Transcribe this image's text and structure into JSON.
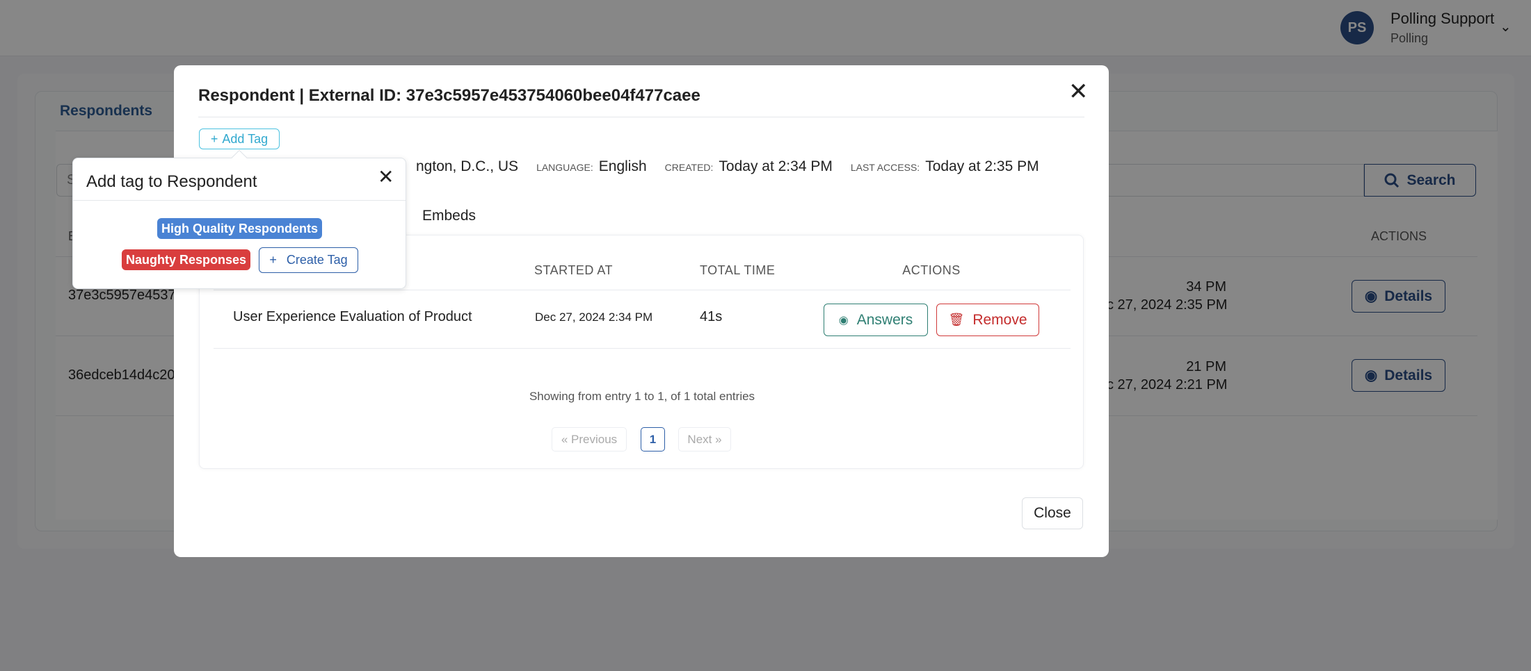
{
  "user": {
    "initials": "PS",
    "name": "Polling Support",
    "org": "Polling"
  },
  "background": {
    "tab": "Respondents",
    "search_button": "Search",
    "column_header_first": "E",
    "column_header_actions": "ACTIONS",
    "rows": [
      {
        "id": "37e3c5957e4537",
        "dates": [
          "34 PM",
          "c 27, 2024 2:35 PM"
        ],
        "action": "Details"
      },
      {
        "id": "36edceb14d4c20",
        "dates": [
          "21 PM",
          "c 27, 2024 2:21 PM"
        ],
        "action": "Details"
      }
    ],
    "search_placeholder_fragment": "S"
  },
  "modal": {
    "title": "Respondent | External ID: 37e3c5957e453754060bee04f477caee",
    "add_tag": "Add Tag",
    "info": {
      "location": "ngton, D.C., US",
      "language_label": "LANGUAGE:",
      "language": "English",
      "created_label": "CREATED:",
      "created": "Today at 2:34 PM",
      "last_access_label": "LAST ACCESS:",
      "last_access": "Today at 2:35 PM"
    },
    "tab": "Embeds",
    "table": {
      "headers": {
        "started_at": "STARTED AT",
        "total_time": "TOTAL TIME",
        "actions": "ACTIONS"
      },
      "rows": [
        {
          "name": "User Experience Evaluation of Product",
          "started_at": "Dec 27, 2024 2:34 PM",
          "total_time": "41s",
          "answers": "Answers",
          "remove": "Remove"
        }
      ],
      "showing": "Showing from entry 1 to 1, of 1 total entries",
      "pagination": {
        "previous": "« Previous",
        "current": "1",
        "next": "Next »"
      }
    },
    "close": "Close"
  },
  "popover": {
    "title": "Add tag to Respondent",
    "tags": [
      {
        "label": "High Quality Respondents",
        "color": "#4a83d4"
      },
      {
        "label": "Naughty Responses",
        "color": "#d93e3e"
      }
    ],
    "create_tag": "Create Tag"
  }
}
